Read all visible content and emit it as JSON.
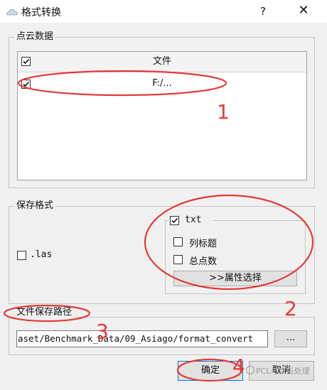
{
  "window": {
    "title": "格式转换",
    "help_label": "?",
    "close_label": "✕"
  },
  "point_cloud": {
    "group_label": "点云数据",
    "column_header": "文件",
    "header_checked": true,
    "rows": [
      {
        "path": "F:/...",
        "checked": true
      }
    ]
  },
  "save_format": {
    "group_label": "保存格式",
    "las_label": ".las",
    "las_checked": false,
    "txt_label": "txt",
    "txt_checked": true,
    "column_title_label": "列标题",
    "column_title_checked": false,
    "total_points_label": "总点数",
    "total_points_checked": false,
    "attribute_select_label": ">>属性选择"
  },
  "save_path": {
    "group_label": "文件保存路径",
    "value": "aset/Benchmark_Data/09_Asiago/format_convert",
    "browse_label": "..."
  },
  "buttons": {
    "ok_label": "确定",
    "cancel_label": "取消"
  },
  "annotations": {
    "color": "#e53935",
    "numbers": [
      "1",
      "2",
      "3",
      "4"
    ]
  },
  "watermark": "PCL与点云处理"
}
